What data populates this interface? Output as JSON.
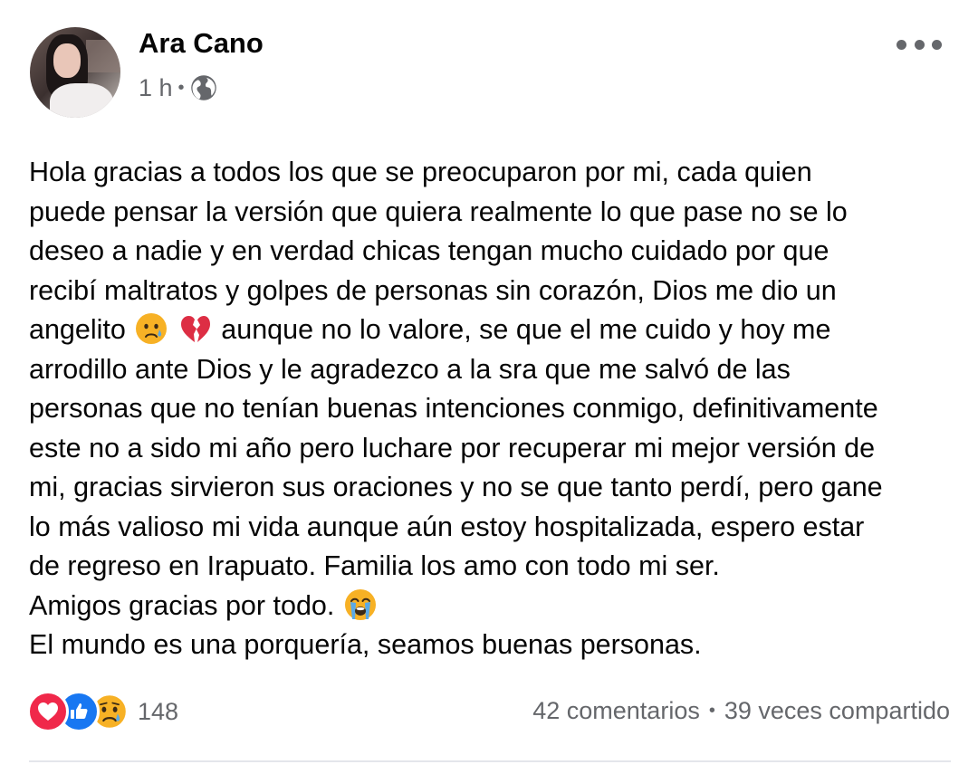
{
  "post": {
    "author": "Ara Cano",
    "time": "1 h",
    "separator": "•",
    "privacy_icon": "globe-icon",
    "more_icon": "more-options-icon",
    "text_lines": [
      "Hola gracias a todos los que se preocuparon por mi, cada quien",
      "puede pensar la versión que quiera realmente lo que pase no se lo",
      "deseo a nadie y en verdad chicas tengan mucho cuidado por que",
      "recibí maltratos y golpes de personas sin corazón, Dios me dio un",
      {
        "before": "angelito",
        "emojis": [
          "sad-tear-emoji",
          "broken-heart-emoji"
        ],
        "after": "aunque no lo valore, se que el me cuido y hoy me"
      },
      "arrodillo ante Dios y le agradezco a la sra que me salvó de las",
      "personas que no tenían buenas intenciones conmigo, definitivamente",
      "este no a sido mi año pero luchare por recuperar mi mejor versión de",
      "mi, gracias sirvieron sus oraciones y no se que tanto perdí, pero gane",
      "lo más valioso mi vida aunque aún estoy hospitalizada, espero estar",
      "de regreso en Irapuato. Familia los amo con todo mi ser.",
      {
        "before": "Amigos gracias por todo.",
        "emojis": [
          "loudly-crying-emoji"
        ],
        "after": ""
      },
      "El mundo es una porquería, seamos buenas personas."
    ]
  },
  "engagement": {
    "reaction_icons": [
      "love-reaction-icon",
      "like-reaction-icon",
      "sad-reaction-icon"
    ],
    "reaction_count": "148",
    "comments": "42 comentarios",
    "separator": "•",
    "shares": "39 veces compartido"
  },
  "colors": {
    "text": "#050505",
    "secondary": "#65676b",
    "like_blue": "#1877f2",
    "love_red": "#f0284a",
    "emoji_yellow": "#f7b125",
    "divider": "#e4e6eb"
  }
}
